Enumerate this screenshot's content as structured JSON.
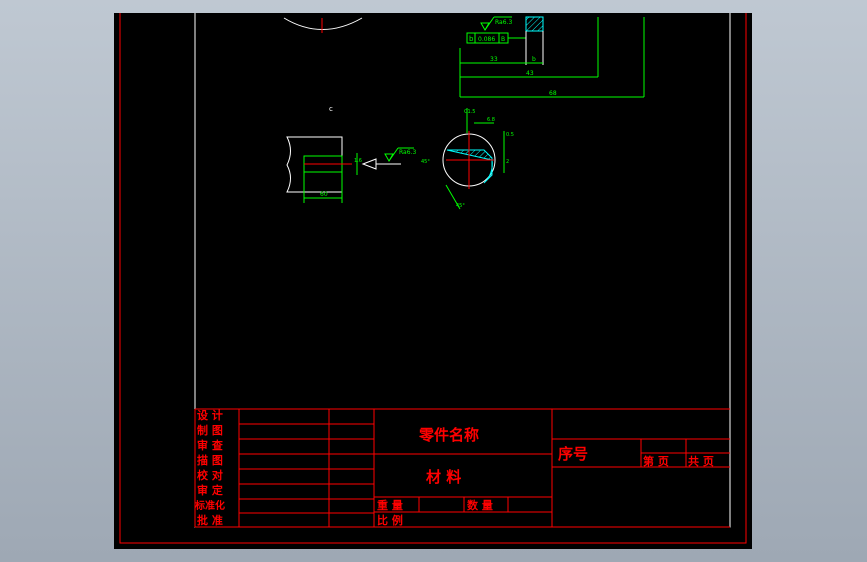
{
  "colors": {
    "background": "#000000",
    "frame": "#ffffff",
    "titleblock": "#ff0000",
    "geometry": "#ffffff",
    "dimension": "#00ff00",
    "centerline": "#ff0000",
    "hatch": "#00ffff"
  },
  "drawing": {
    "top_dims": {
      "roughness": "Ra6.3",
      "tolerance_box": [
        "b",
        "0.086",
        "B"
      ],
      "dim_a": "33",
      "dim_b": "b",
      "dim_c": "43",
      "dim_d": "68"
    },
    "view_label": "c",
    "left_view": {
      "roughness": "Ra6.3",
      "dim_width": "60",
      "dim_side": "1.6"
    },
    "section": {
      "chamfer": "C1.5",
      "dim_top": "6.8",
      "dim_right_a": "0.5",
      "dim_right_b": "2",
      "angle_left": "45°",
      "angle_bottom": "45°"
    }
  },
  "titleblock": {
    "left_labels": [
      "设 计",
      "制 图",
      "审 查",
      "描 图",
      "校 对",
      "审 定",
      "标准化",
      "批 准"
    ],
    "part_name": "零件名称",
    "material": "材 料",
    "weight_label": "重 量",
    "quantity_label": "数 量",
    "scale_label": "比 例",
    "serial_label": "序号",
    "sheet_label": "第  页",
    "total_label": "共  页"
  }
}
